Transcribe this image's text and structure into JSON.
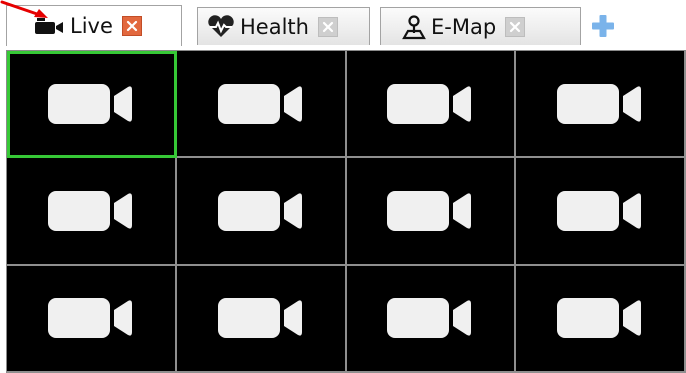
{
  "tabs": [
    {
      "label": "Live",
      "icon": "camera-icon",
      "active": true,
      "close": "close-icon"
    },
    {
      "label": "Health",
      "icon": "heart-pulse-icon",
      "active": false,
      "close": "close-icon"
    },
    {
      "label": "E-Map",
      "icon": "map-pin-icon",
      "active": false,
      "close": "close-icon"
    }
  ],
  "add_tab": {
    "icon": "plus-icon"
  },
  "colors": {
    "active_close": "#e2683e",
    "inactive_close": "#cfcfcf",
    "selected_border": "#36c836",
    "plus": "#7ab3ea",
    "annotation_arrow": "#e60000"
  },
  "grid": {
    "rows": 3,
    "cols": 4,
    "selected_cell": 1,
    "cell_icon": "video-camera-icon"
  }
}
